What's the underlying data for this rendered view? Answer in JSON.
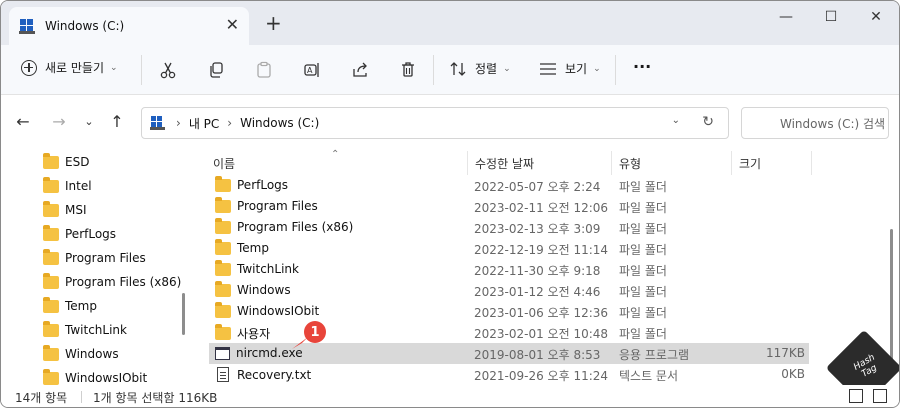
{
  "tab": {
    "title": "Windows (C:)",
    "close": "✕"
  },
  "titlebar": {
    "new_tab": "+",
    "minimize": "—",
    "maximize": "☐",
    "close": "✕"
  },
  "commandbar": {
    "new_label": "새로 만들기",
    "sort_label": "정렬",
    "view_label": "보기",
    "more": "···"
  },
  "address": {
    "crumbs": [
      "내 PC",
      "Windows (C:)"
    ],
    "search_placeholder": "Windows (C:) 검색"
  },
  "navpane": {
    "items": [
      "ESD",
      "Intel",
      "MSI",
      "PerfLogs",
      "Program Files",
      "Program Files (x86)",
      "Temp",
      "TwitchLink",
      "Windows",
      "WindowsIObit"
    ]
  },
  "columns": {
    "name": "이름",
    "date": "수정한 날짜",
    "type": "유형",
    "size": "크기"
  },
  "files": [
    {
      "name": "PerfLogs",
      "date": "2022-05-07 오후 2:24",
      "type": "파일 폴더",
      "size": "",
      "kind": "folder"
    },
    {
      "name": "Program Files",
      "date": "2023-02-11 오전 12:06",
      "type": "파일 폴더",
      "size": "",
      "kind": "folder"
    },
    {
      "name": "Program Files (x86)",
      "date": "2023-02-13 오후 3:09",
      "type": "파일 폴더",
      "size": "",
      "kind": "folder"
    },
    {
      "name": "Temp",
      "date": "2022-12-19 오전 11:14",
      "type": "파일 폴더",
      "size": "",
      "kind": "folder"
    },
    {
      "name": "TwitchLink",
      "date": "2022-11-30 오후 9:18",
      "type": "파일 폴더",
      "size": "",
      "kind": "folder"
    },
    {
      "name": "Windows",
      "date": "2023-01-12 오전 4:46",
      "type": "파일 폴더",
      "size": "",
      "kind": "folder"
    },
    {
      "name": "WindowsIObit",
      "date": "2023-01-06 오후 12:36",
      "type": "파일 폴더",
      "size": "",
      "kind": "folder"
    },
    {
      "name": "사용자",
      "date": "2023-02-01 오전 10:48",
      "type": "파일 폴더",
      "size": "",
      "kind": "folder"
    },
    {
      "name": "nircmd.exe",
      "date": "2019-08-01 오후 8:53",
      "type": "응용 프로그램",
      "size": "117KB",
      "kind": "exe"
    },
    {
      "name": "Recovery.txt",
      "date": "2021-09-26 오후 11:24",
      "type": "텍스트 문서",
      "size": "0KB",
      "kind": "txt"
    }
  ],
  "callout": {
    "number": "1"
  },
  "watermark": {
    "line1": "Hash",
    "line2": "Tag"
  },
  "status": {
    "count": "14개 항목",
    "selection": "1개 항목 선택함 116KB"
  },
  "colors": {
    "folder": "#f5c242",
    "selected_row": "#d9d9d9",
    "badge": "#e8443a"
  }
}
